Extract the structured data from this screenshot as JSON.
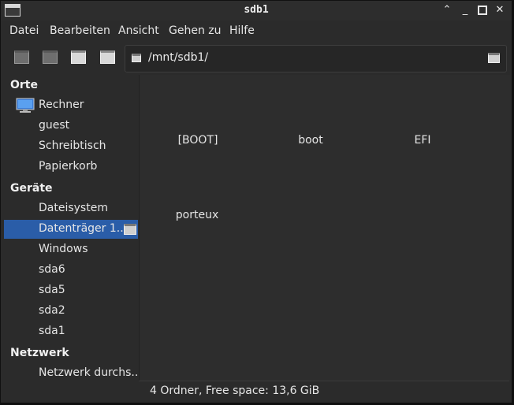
{
  "window": {
    "title": "sdb1",
    "controls": [
      "chevron-up-icon",
      "minimize-icon",
      "maximize-icon",
      "close-icon"
    ]
  },
  "menu": [
    "Datei",
    "Bearbeiten",
    "Ansicht",
    "Gehen zu",
    "Hilfe"
  ],
  "toolbar": {
    "buttons": [
      "back-icon",
      "forward-icon",
      "parent-folder-icon",
      "home-icon"
    ]
  },
  "location": {
    "path": "/mnt/sdb1/"
  },
  "sidebar": {
    "places_header": "Orte",
    "places": [
      "Rechner",
      "guest",
      "Schreibtisch",
      "Papierkorb"
    ],
    "devices_header": "Geräte",
    "devices": [
      "Dateisystem",
      "Datenträger 1...",
      "Windows",
      "sda6",
      "sda5",
      "sda2",
      "sda1"
    ],
    "selected_device": "Datenträger 1...",
    "network_header": "Netzwerk",
    "network": [
      "Netzwerk durchs..."
    ]
  },
  "files": [
    "[BOOT]",
    "boot",
    "EFI",
    "porteux"
  ],
  "status": {
    "text": "4 Ordner, Free space: 13,6 GiB"
  },
  "colors": {
    "selection": "#2a5da8",
    "background": "#2b2b2b"
  }
}
